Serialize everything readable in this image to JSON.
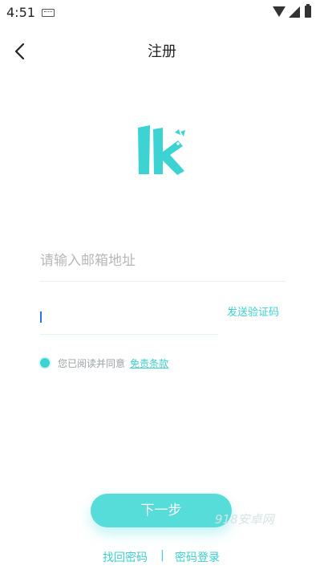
{
  "status_bar": {
    "time": "4:51",
    "icons": [
      "keyboard-icon",
      "wifi-icon",
      "signal-icon",
      "battery-icon"
    ]
  },
  "header": {
    "title": "注册",
    "back_icon": "chevron-left-icon"
  },
  "logo": {
    "text": "lk",
    "color": "#3ed3d3"
  },
  "form": {
    "email_placeholder": "请输入邮箱地址",
    "email_value": "",
    "code_value": "",
    "send_code_label": "发送验证码",
    "agree_text": "您已阅读并同意",
    "terms_link": "免责条款",
    "agree_checked": true
  },
  "actions": {
    "next_label": "下一步"
  },
  "bottom": {
    "find_password": "找回密码",
    "divider": "|",
    "password_login": "密码登录"
  },
  "watermark": "918安卓网",
  "colors": {
    "accent": "#3ed3d3",
    "button": "#56dcd9",
    "caret": "#2f72e8"
  }
}
